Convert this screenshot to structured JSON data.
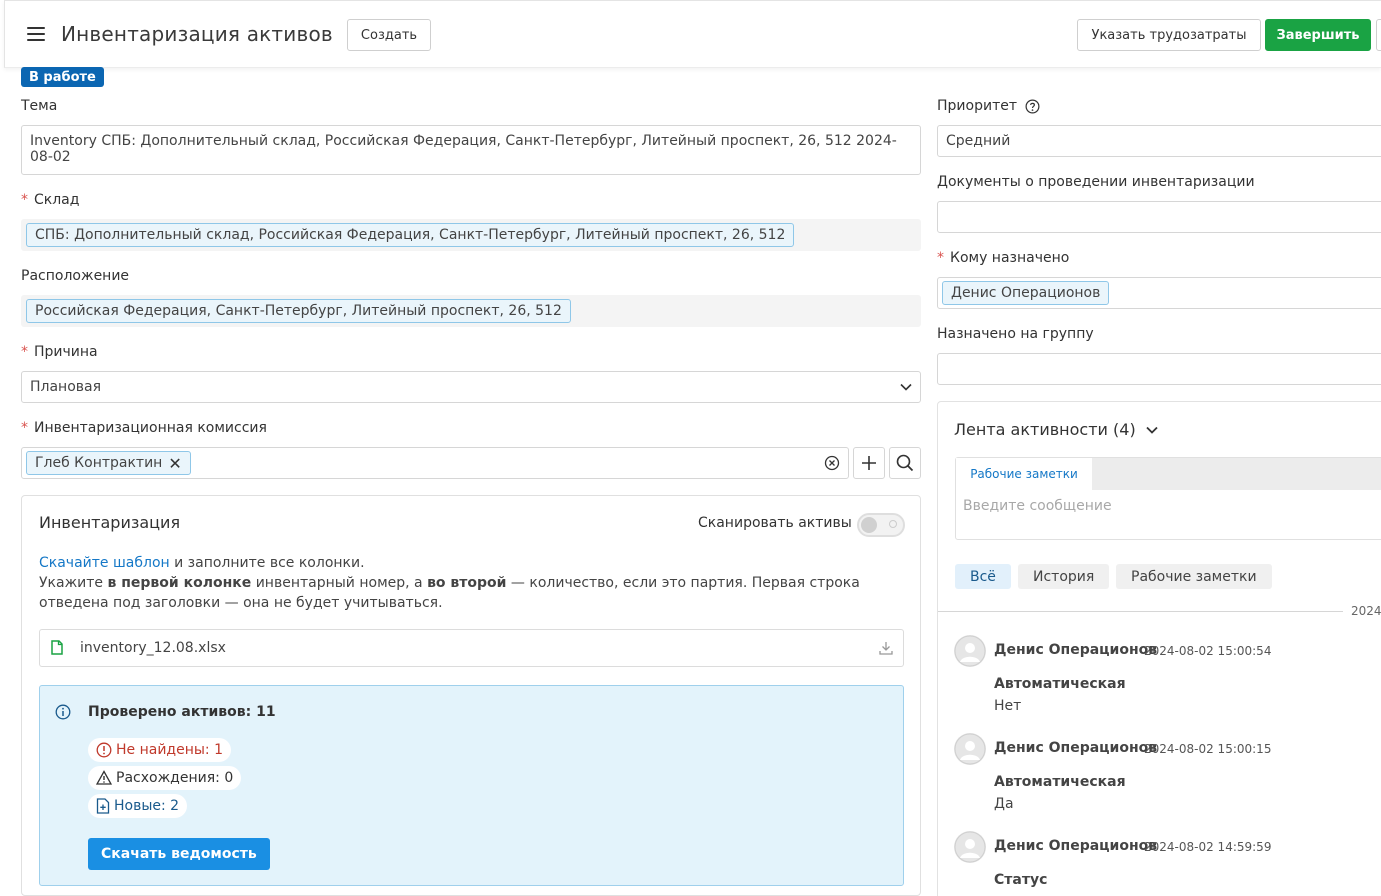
{
  "header": {
    "title": "Инвентаризация активов",
    "create_label": "Создать",
    "time_label": "Указать трудозатраты",
    "finish_label": "Завершить",
    "finish_color": "#1aa344"
  },
  "status": {
    "label": "В работе",
    "color": "#0b66b2"
  },
  "left": {
    "subject": {
      "label": "Тема",
      "value": "Inventory СПБ: Дополнительный склад, Российская Федерация, Санкт-Петербург, Литейный проспект, 26, 512 2024-08-02"
    },
    "warehouse": {
      "required_mark": "*",
      "label": "Склад",
      "value": "СПБ: Дополнительный склад, Российская Федерация, Санкт-Петербург, Литейный проспект, 26, 512"
    },
    "location": {
      "label": "Расположение",
      "value": "Российская Федерация, Санкт-Петербург, Литейный проспект, 26, 512"
    },
    "reason": {
      "required_mark": "*",
      "label": "Причина",
      "value": "Плановая"
    },
    "commission": {
      "required_mark": "*",
      "label": "Инвентаризационная комиссия",
      "member": "Глеб Контрактин"
    }
  },
  "inventory": {
    "title": "Инвентаризация",
    "scan_label": "Сканировать активы",
    "scan_enabled": false,
    "template_link": "Скачайте шаблон",
    "text_1": " и заполните все колонки.",
    "text_2a": "Укажите ",
    "text_2b": "в первой колонке",
    "text_2c": " инвентарный номер, а ",
    "text_2d": "во второй",
    "text_2e": " — количество, если это партия. Первая строка отведена под заголовки — она не будет учитываться.",
    "file_name": "inventory_12.08.xlsx",
    "checked_title": "Проверено активов: 11",
    "not_found": "Не найдены: 1",
    "discrepancies": "Расхождения: 0",
    "new_items": "Новые: 2",
    "download_label": "Скачать ведомость",
    "colors": {
      "not_found": "#c0392b",
      "new": "#1a5a8c",
      "info": "#1578c7"
    }
  },
  "right": {
    "priority": {
      "label": "Приоритет",
      "value": "Средний"
    },
    "documents": {
      "label": "Документы о проведении инвентаризации",
      "value": ""
    },
    "assignee": {
      "required_mark": "*",
      "label": "Кому назначено",
      "value": "Денис Операционов"
    },
    "group": {
      "label": "Назначено на группу",
      "value": ""
    }
  },
  "activity": {
    "title": "Лента активности (4)",
    "note_tab": "Рабочие заметки",
    "note_placeholder": "Введите сообщение",
    "filters": [
      "Всё",
      "История",
      "Рабочие заметки"
    ],
    "date_separator": "2024-",
    "entries": [
      {
        "author": "Денис Операционов",
        "time": "2024-08-02 15:00:54",
        "field": "Автоматическая",
        "value": "Нет"
      },
      {
        "author": "Денис Операционов",
        "time": "2024-08-02 15:00:15",
        "field": "Автоматическая",
        "value": "Да"
      },
      {
        "author": "Денис Операционов",
        "time": "2024-08-02 14:59:59",
        "field": "Статус",
        "value": ""
      }
    ]
  }
}
